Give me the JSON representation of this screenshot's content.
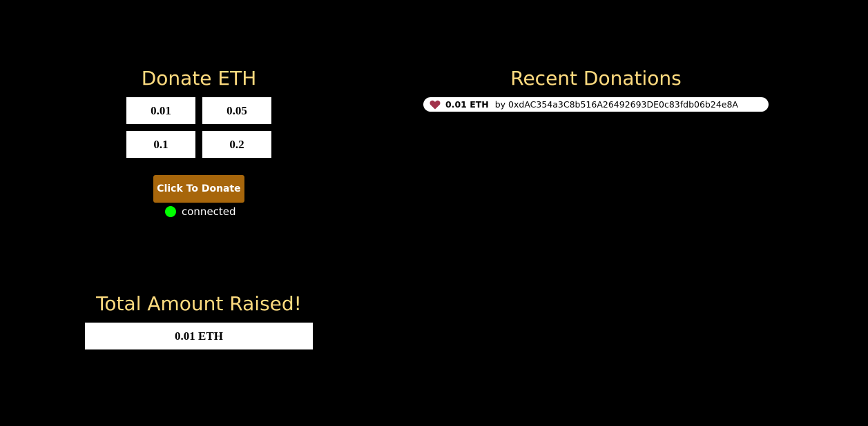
{
  "donate": {
    "title": "Donate ETH",
    "amounts": [
      "0.01",
      "0.05",
      "0.1",
      "0.2"
    ],
    "button_label": "Click To Donate",
    "status_text": "connected"
  },
  "recent": {
    "title": "Recent Donations",
    "donations": [
      {
        "amount": "0.01 ETH",
        "by": "by 0xdAC354a3C8b516A26492693DE0c83fdb06b24e8A"
      }
    ]
  },
  "total": {
    "title": "Total Amount Raised!",
    "value": "0.01 ETH"
  },
  "icons": {
    "status": "status-dot-icon",
    "donation": "heart-icon"
  },
  "colors": {
    "background": "#000000",
    "heading": "#fedb7f",
    "button": "#a7660b",
    "status_connected": "#00ff00",
    "heart": "#a1314a"
  }
}
